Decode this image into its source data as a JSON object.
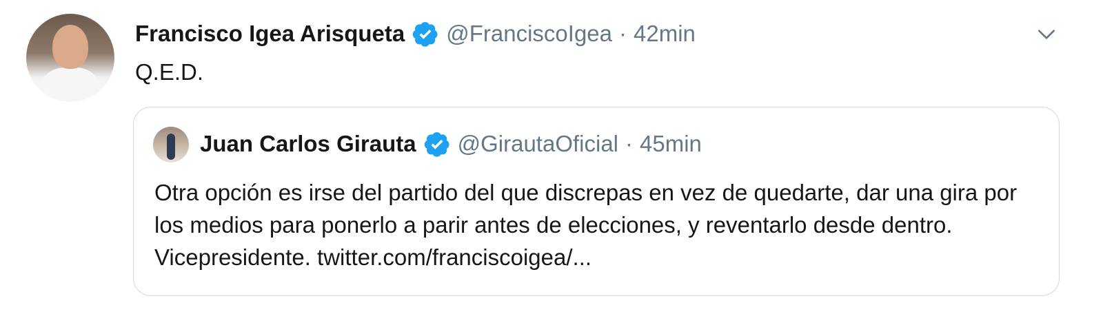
{
  "tweet": {
    "author_name": "Francisco Igea Arisqueta",
    "author_handle": "@FranciscoIgea",
    "separator": "·",
    "time": "42min",
    "text": "Q.E.D."
  },
  "quoted_tweet": {
    "author_name": "Juan Carlos Girauta",
    "author_handle": "@GirautaOficial",
    "separator": "·",
    "time": "45min",
    "text": "Otra opción es irse del partido del que discrepas en vez de quedarte, dar una gira por los medios para ponerlo a parir antes de elecciones, y reventarlo desde dentro. Vicepresidente. twitter.com/franciscoigea/..."
  },
  "icons": {
    "verified": "verified-badge-icon",
    "menu": "chevron-down-icon"
  },
  "colors": {
    "verified_blue": "#1da1f2",
    "secondary_text": "#657786",
    "border": "#cfd9de"
  }
}
